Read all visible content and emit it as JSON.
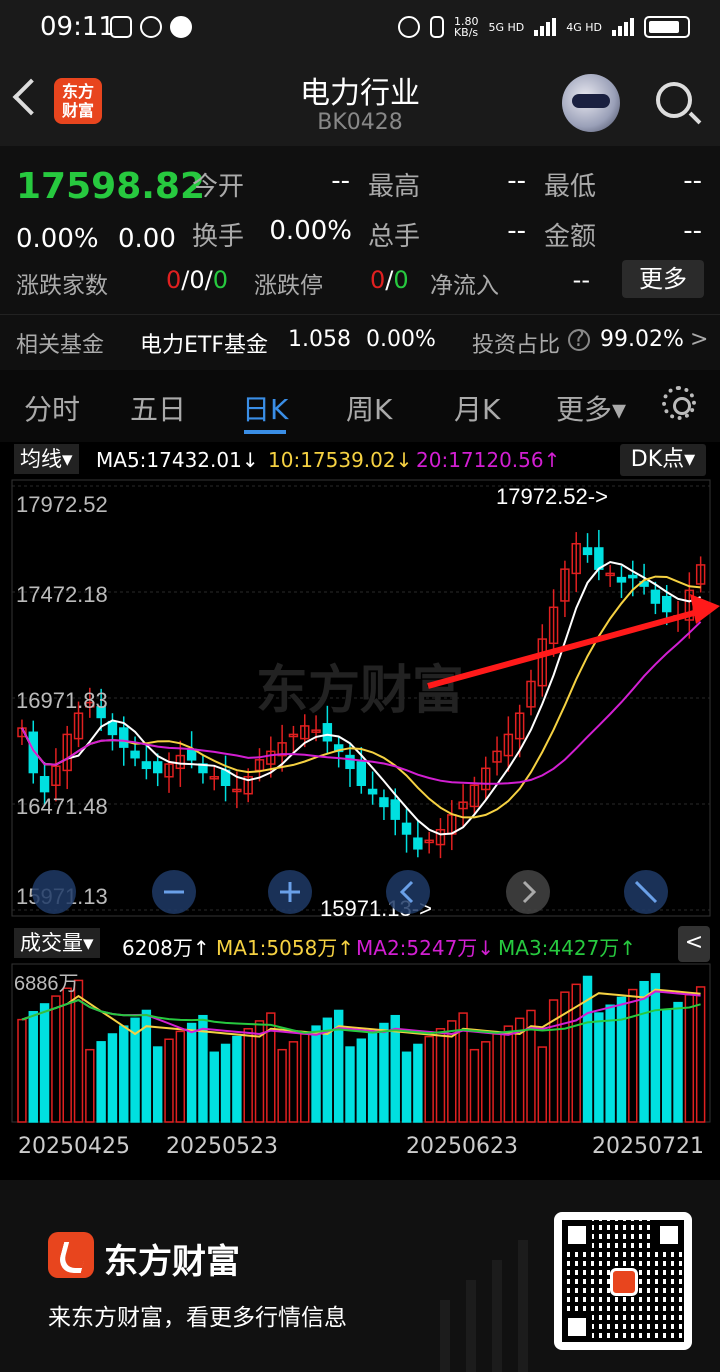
{
  "status_bar": {
    "time": "09:11",
    "net_speed": "1.80\nKB/s",
    "net1": "5G HD",
    "net2": "4G HD"
  },
  "header": {
    "title": "电力行业",
    "code": "BK0428",
    "logo_text": "东方\n财富"
  },
  "quote": {
    "price": "17598.82",
    "change_pct": "0.00%",
    "change_val": "0.00",
    "open_label": "今开",
    "open_val": "--",
    "high_label": "最高",
    "high_val": "--",
    "low_label": "最低",
    "low_val": "--",
    "turnover_label": "换手",
    "turnover_val": "0.00%",
    "total_hand_label": "总手",
    "total_hand_val": "--",
    "amount_label": "金额",
    "amount_val": "--",
    "updown_label": "涨跌家数",
    "updown_a": "0",
    "updown_b": "0",
    "updown_c": "0",
    "limit_label": "涨跌停",
    "limit_a": "0",
    "limit_b": "0",
    "netflow_label": "净流入",
    "netflow_val": "--",
    "more_button": "更多",
    "slash": "/"
  },
  "fund": {
    "label": "相关基金",
    "name": "电力ETF基金",
    "value": "1.058",
    "pct": "0.00%",
    "ratio_label": "投资占比",
    "ratio_val": "99.02%",
    "arrow": ">"
  },
  "tabs": [
    {
      "label": "分时"
    },
    {
      "label": "五日"
    },
    {
      "label": "日K"
    },
    {
      "label": "周K"
    },
    {
      "label": "月K"
    },
    {
      "label": "更多▾"
    }
  ],
  "ma_legend": {
    "button": "均线▾",
    "ma5": "MA5:17432.01↓",
    "ma10": "10:17539.02↓",
    "ma20": "20:17120.56↑",
    "dk_button": "DK点▾"
  },
  "colors": {
    "up": "#e02020",
    "down": "#00e0e0",
    "ma5": "#ffffff",
    "ma10": "#f5d142",
    "ma20": "#d21fd2",
    "vol_ma1": "#f5d142",
    "vol_ma2": "#d21fd2",
    "vol_ma3": "#27c93f",
    "arrow": "#ff1a1a"
  },
  "chart_data": {
    "type": "candlestick",
    "y_ticks": [
      "17972.52",
      "17472.18",
      "16971.83",
      "16471.48",
      "15971.13"
    ],
    "ylim": [
      15971.13,
      17972.52
    ],
    "max_annotation": "17972.52->",
    "min_annotation": "15971.13->",
    "watermark": "东方财富",
    "x_labels": [
      "20250425",
      "20250523",
      "20250623",
      "20250721"
    ]
  },
  "volume": {
    "button": "成交量▾",
    "current": "6208万↑",
    "ma1": "MA1:5058万↑",
    "ma2": "MA2:5247万↓",
    "ma3": "MA3:4427万↑",
    "max_label": "6886万",
    "collapse": "<"
  },
  "footer": {
    "brand": "东方财富",
    "slogan": "来东方财富，看更多行情信息"
  }
}
